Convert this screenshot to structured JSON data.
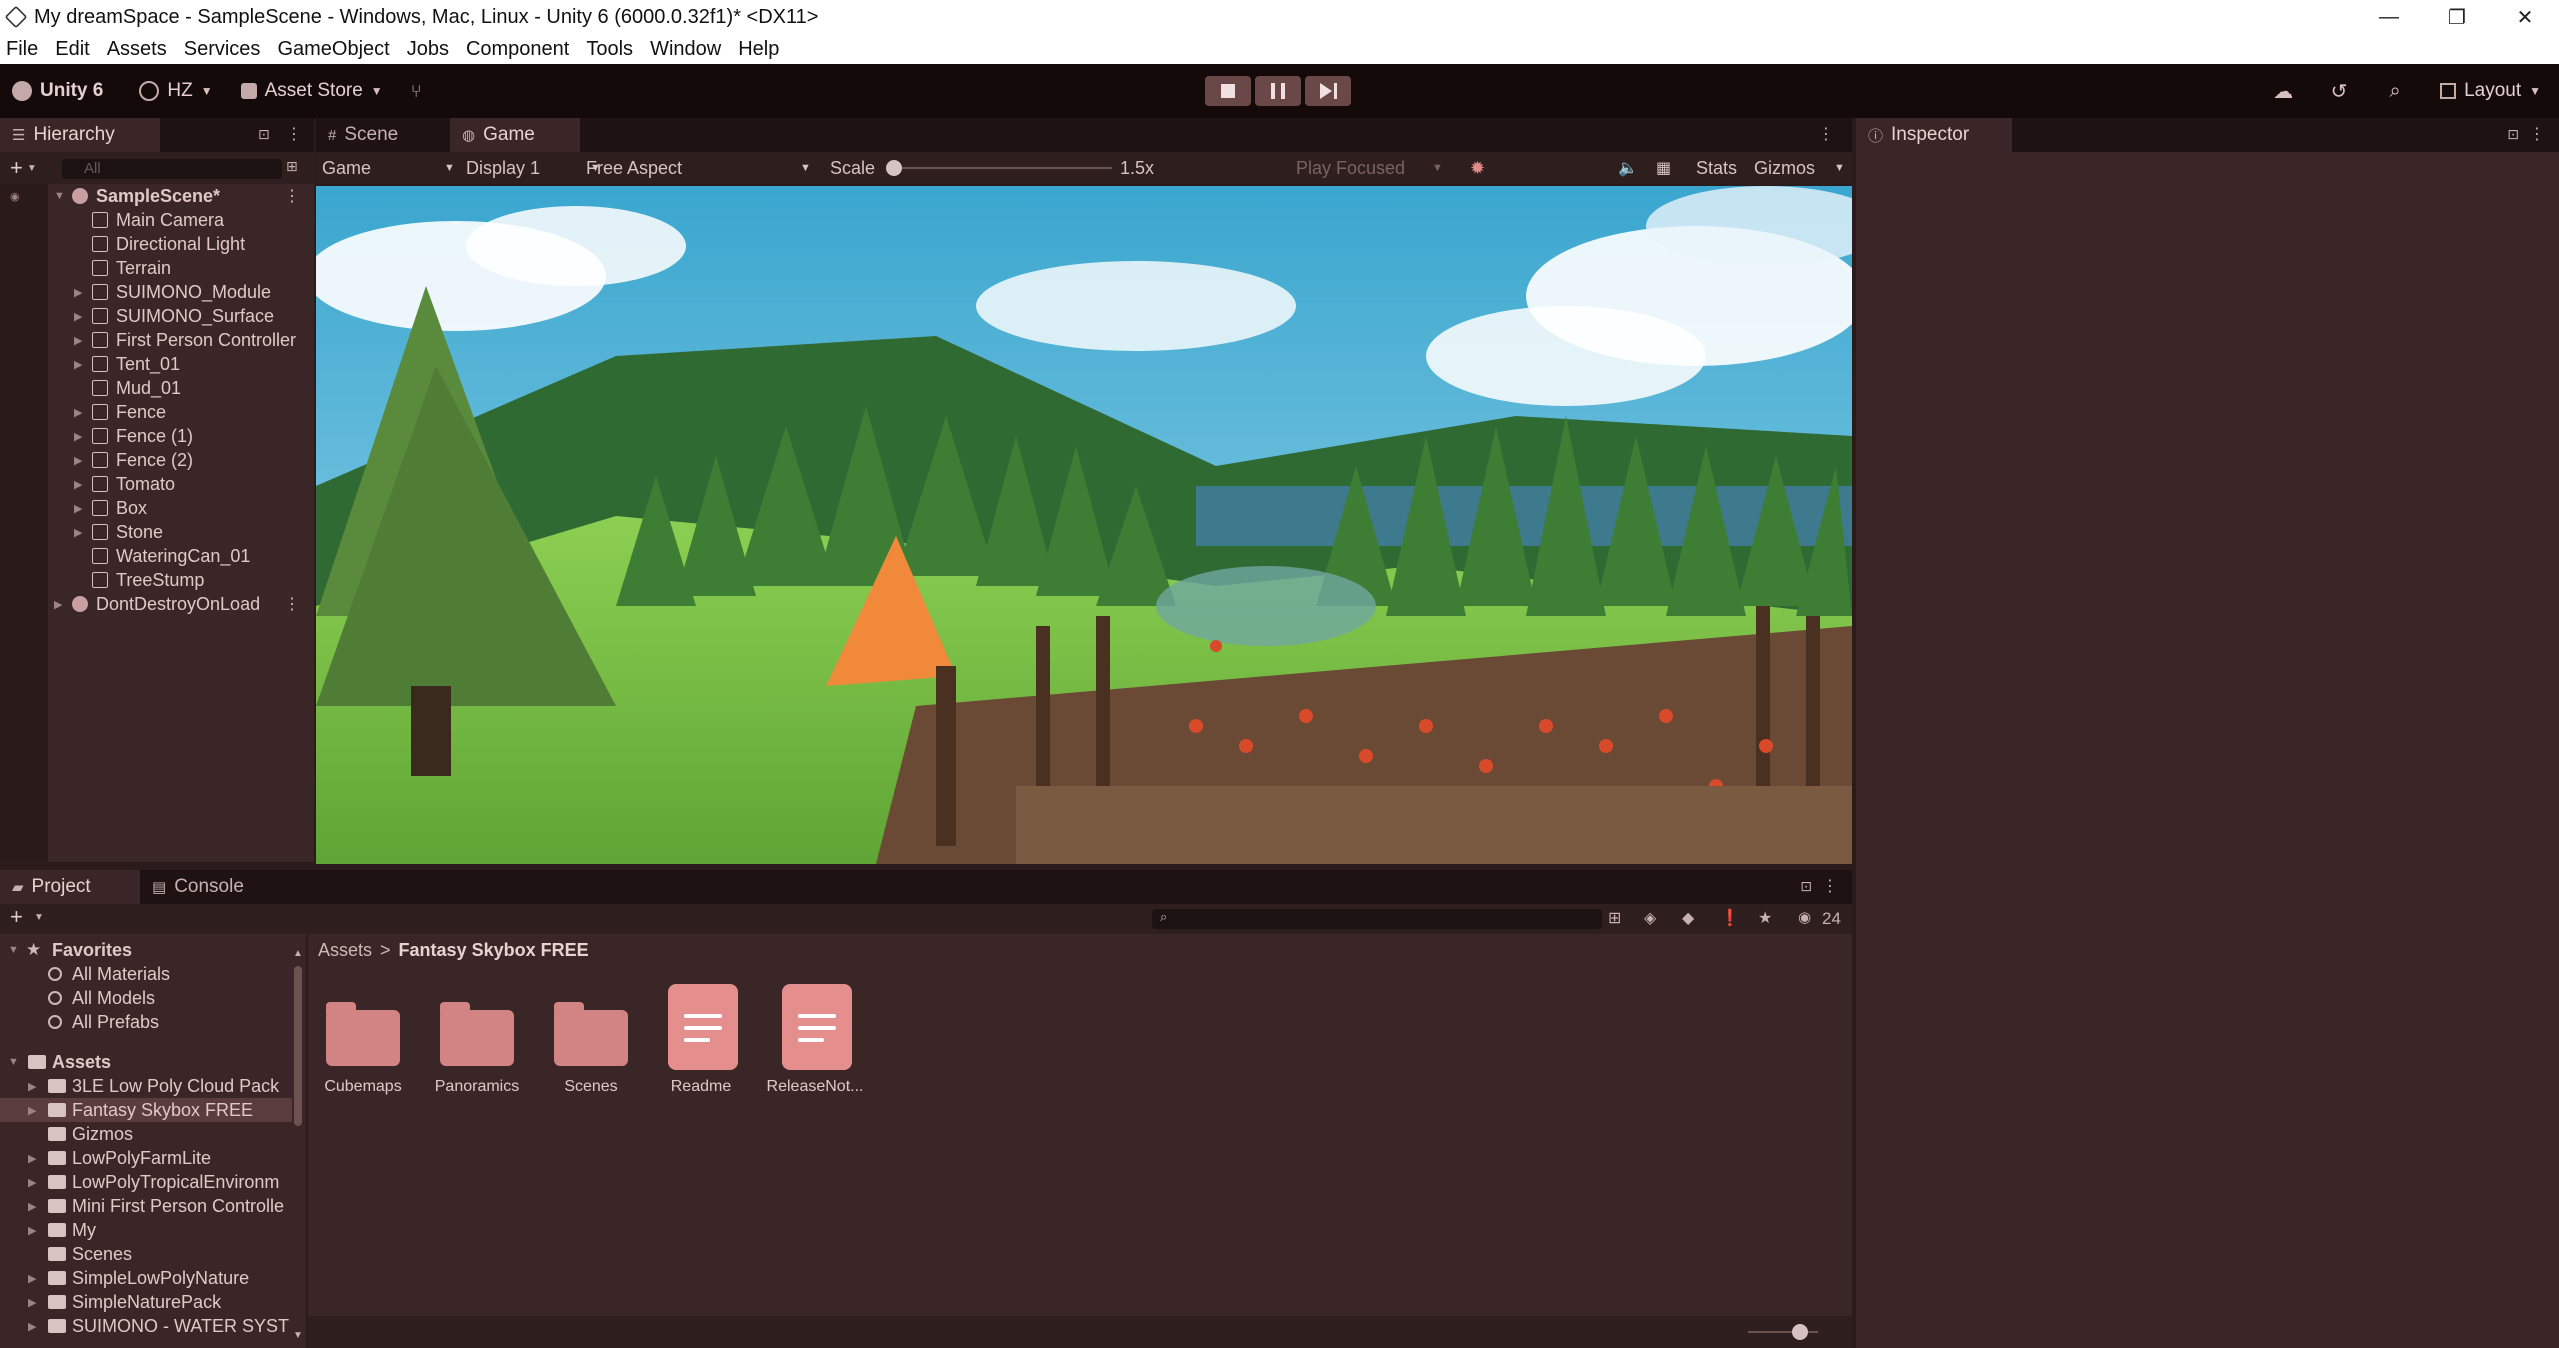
{
  "window": {
    "title": "My dreamSpace - SampleScene - Windows, Mac, Linux - Unity 6 (6000.0.32f1)* <DX11>",
    "minimize": "—",
    "restore": "❐",
    "close": "✕"
  },
  "menu": [
    "File",
    "Edit",
    "Assets",
    "Services",
    "GameObject",
    "Jobs",
    "Component",
    "Tools",
    "Window",
    "Help"
  ],
  "toolbar": {
    "product": "Unity 6",
    "account": "HZ",
    "asset_store": "Asset Store",
    "layout": "Layout"
  },
  "hierarchy": {
    "tab": "Hierarchy",
    "search_placeholder": "All",
    "scene": "SampleScene*",
    "items": [
      "Main Camera",
      "Directional Light",
      "Terrain",
      "SUIMONO_Module",
      "SUIMONO_Surface",
      "First Person Controller",
      "Tent_01",
      "Mud_01",
      "Fence",
      "Fence (1)",
      "Fence (2)",
      "Tomato",
      "Box",
      "Stone",
      "WateringCan_01",
      "TreeStump"
    ],
    "dont_destroy": "DontDestroyOnLoad"
  },
  "scene_tab": "Scene",
  "game_tab": "Game",
  "game_toolbar": {
    "mode": "Game",
    "display": "Display 1",
    "aspect": "Free Aspect",
    "scale_label": "Scale",
    "scale_value": "1.5x",
    "play_focused": "Play Focused",
    "stats": "Stats",
    "gizmos": "Gizmos"
  },
  "inspector": {
    "tab": "Inspector"
  },
  "project": {
    "tab": "Project",
    "console_tab": "Console",
    "hidden_count": "24",
    "favorites": "Favorites",
    "favorite_items": [
      "All Materials",
      "All Models",
      "All Prefabs"
    ],
    "assets": "Assets",
    "asset_folders": [
      "3LE Low Poly Cloud Pack",
      "Fantasy Skybox FREE",
      "Gizmos",
      "LowPolyFarmLite",
      "LowPolyTropicalEnvironm",
      "Mini First Person Controlle",
      "My",
      "Scenes",
      "SimpleLowPolyNature",
      "SimpleNaturePack",
      "SUIMONO - WATER SYST"
    ],
    "breadcrumb_root": "Assets",
    "breadcrumb_sep": ">",
    "breadcrumb_current": "Fantasy Skybox FREE",
    "grid_items": [
      "Cubemaps",
      "Panoramics",
      "Scenes",
      "Readme",
      "ReleaseNot..."
    ]
  }
}
